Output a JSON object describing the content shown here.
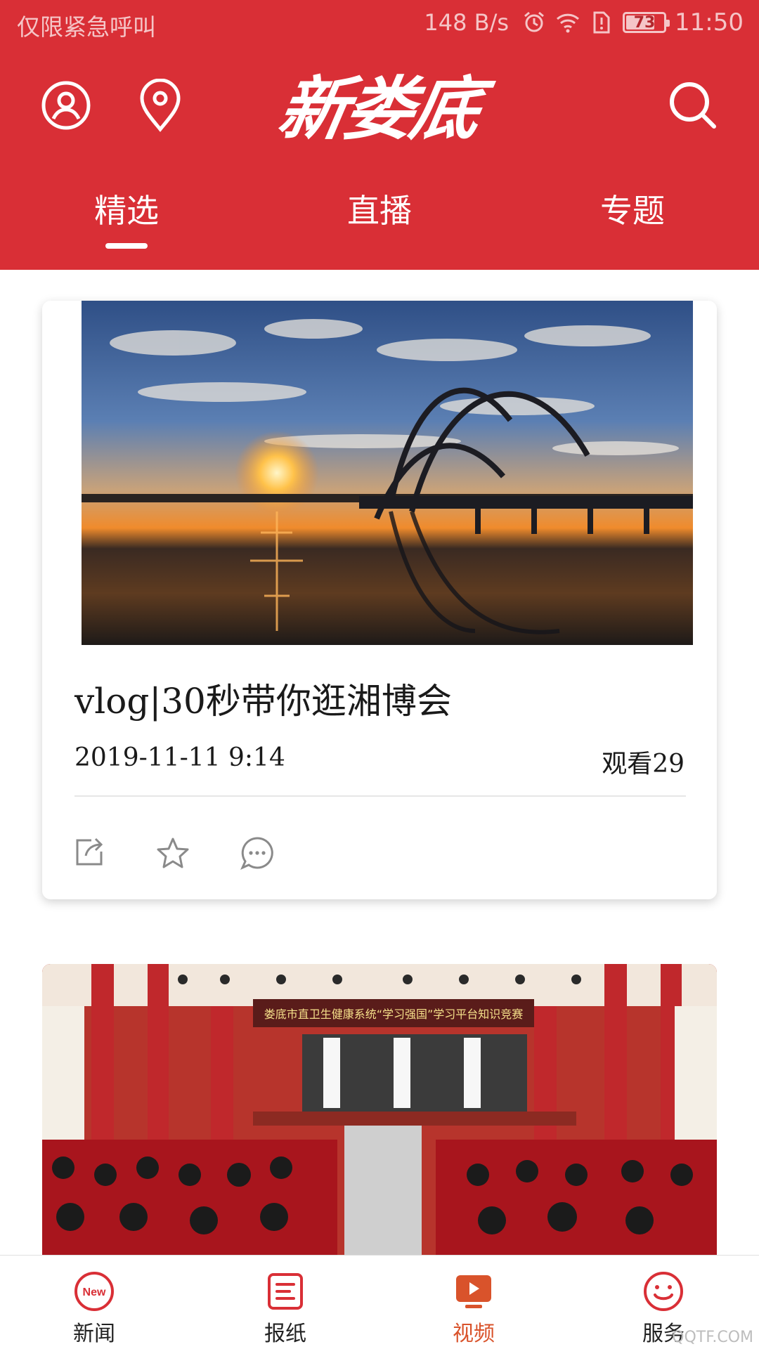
{
  "status_bar": {
    "carrier_text": "仅限紧急呼叫",
    "net_speed": "148 B/s",
    "battery": "73",
    "time": "11:50",
    "icons": [
      "alarm-icon",
      "wifi-icon",
      "sim-alert-icon",
      "battery-icon"
    ]
  },
  "header": {
    "logo_text": "新娄底",
    "left_icons": [
      "user-icon",
      "location-icon"
    ],
    "right_icon": "search-icon",
    "tabs": [
      {
        "label": "精选",
        "active": true
      },
      {
        "label": "直播",
        "active": false
      },
      {
        "label": "专题",
        "active": false
      }
    ]
  },
  "feed": {
    "items": [
      {
        "title": "vlog|30秒带你逛湘博会",
        "date": "2019-11-11 9:14",
        "views": "观看29",
        "image": "sunset-bridge-photo",
        "actions": [
          "share-icon",
          "star-icon",
          "comment-icon"
        ]
      },
      {
        "image": "auditorium-photo",
        "banner_text": "娄底市直卫生健康系统“学习强国”学习平台知识竞赛"
      }
    ]
  },
  "bottom_nav": {
    "items": [
      {
        "label": "新闻",
        "icon": "new-badge-icon",
        "active": false
      },
      {
        "label": "报纸",
        "icon": "newspaper-icon",
        "active": false
      },
      {
        "label": "视频",
        "icon": "video-play-icon",
        "active": true
      },
      {
        "label": "服务",
        "icon": "smiley-icon",
        "active": false
      }
    ]
  },
  "colors": {
    "brand_red": "#d92f36",
    "active_orange": "#d9532b"
  },
  "watermark": "QQTF.COM"
}
